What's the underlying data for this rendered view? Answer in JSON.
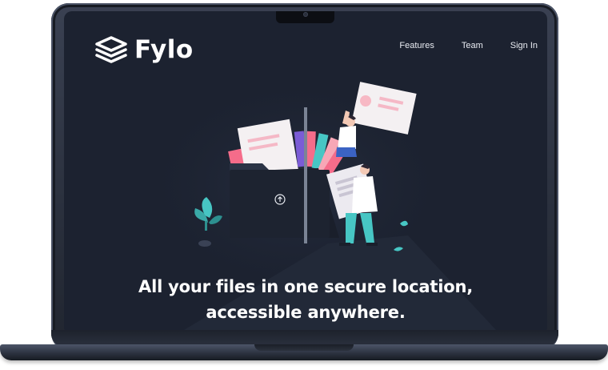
{
  "brand": {
    "name": "Fylo"
  },
  "nav": {
    "items": [
      {
        "label": "Features"
      },
      {
        "label": "Team"
      },
      {
        "label": "Sign In"
      }
    ]
  },
  "hero": {
    "title_line1": "All your files in one secure location,",
    "title_line2": "accessible anywhere."
  },
  "colors": {
    "screen_background": "#1c2230",
    "text": "#ffffff",
    "accent_teal": "#47c6c4",
    "accent_pink": "#f56c8a"
  },
  "icons": {
    "logo": "stacked-layers-icon",
    "upload": "upload-arrow-icon"
  }
}
